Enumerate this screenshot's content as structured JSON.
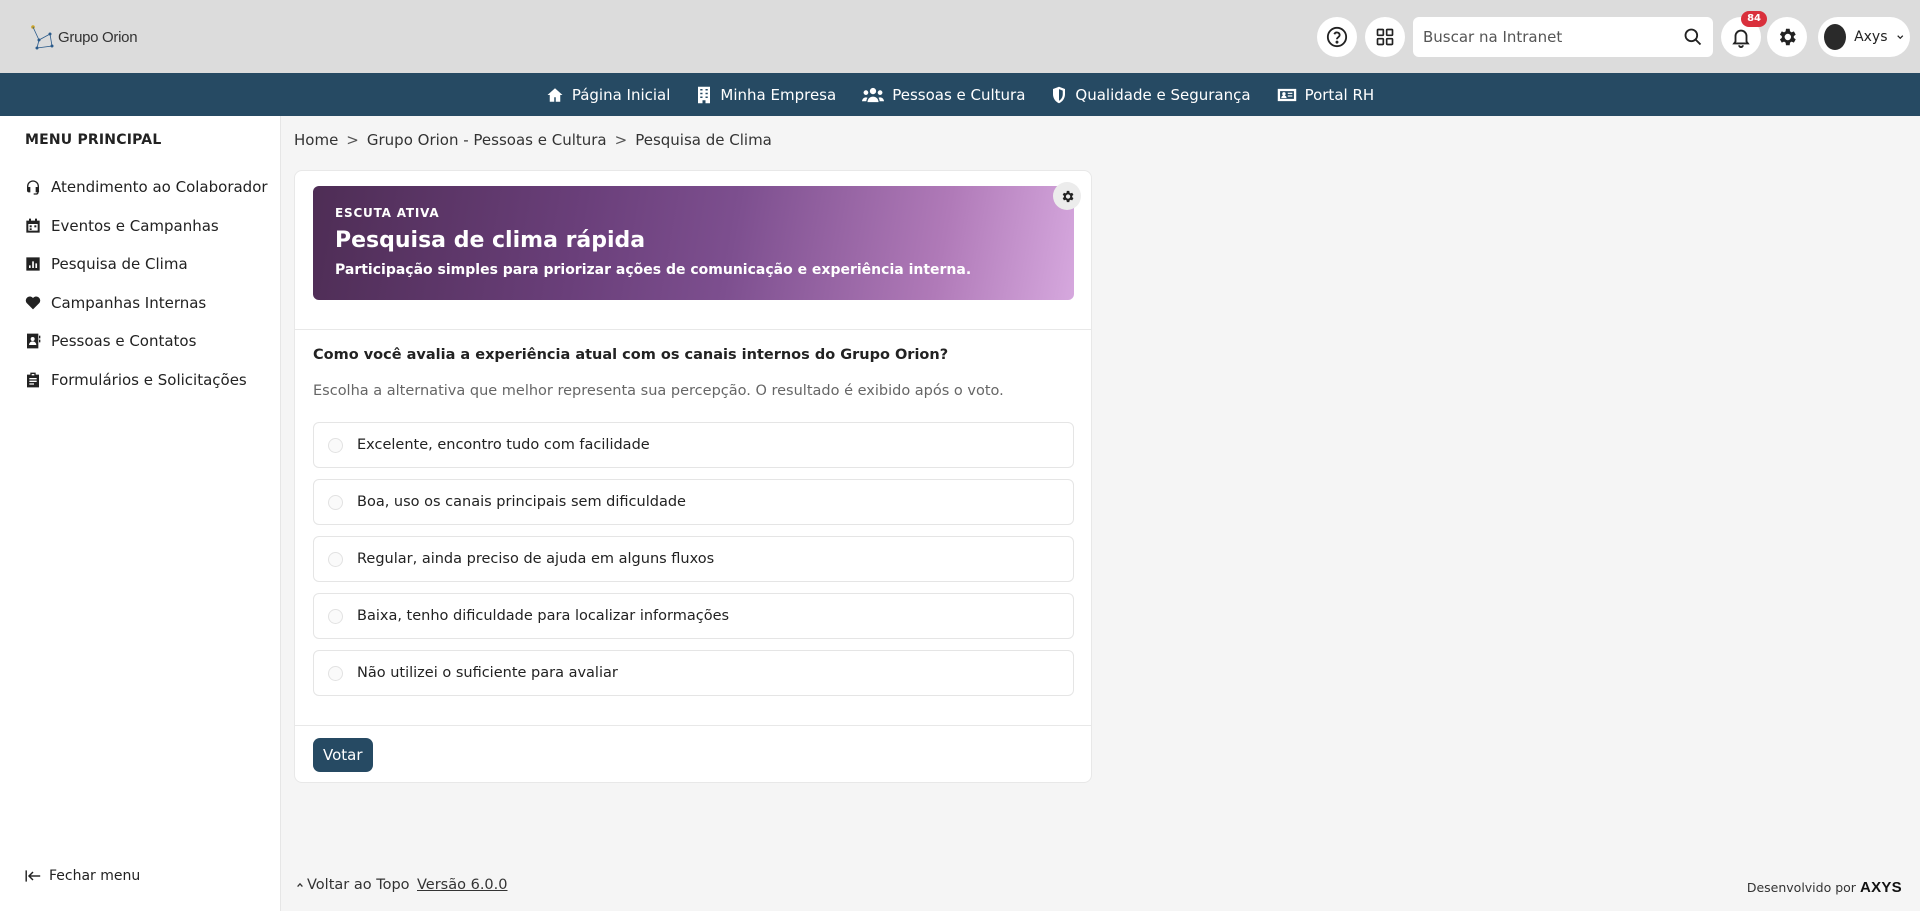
{
  "brand": {
    "name": "Grupo Orion"
  },
  "header": {
    "search_placeholder": "Buscar na Intranet",
    "notification_count": "84",
    "user_name": "Axys"
  },
  "nav": {
    "items": [
      {
        "label": "Página Inicial",
        "icon": "home-icon"
      },
      {
        "label": "Minha Empresa",
        "icon": "building-icon"
      },
      {
        "label": "Pessoas e Cultura",
        "icon": "people-icon"
      },
      {
        "label": "Qualidade e Segurança",
        "icon": "shield-icon"
      },
      {
        "label": "Portal RH",
        "icon": "id-card-icon"
      }
    ]
  },
  "sidebar": {
    "title": "MENU PRINCIPAL",
    "items": [
      {
        "label": "Atendimento ao Colaborador",
        "icon": "headset-icon"
      },
      {
        "label": "Eventos e Campanhas",
        "icon": "calendar-icon"
      },
      {
        "label": "Pesquisa de Clima",
        "icon": "chart-icon"
      },
      {
        "label": "Campanhas Internas",
        "icon": "heart-icon"
      },
      {
        "label": "Pessoas e Contatos",
        "icon": "contact-book-icon"
      },
      {
        "label": "Formulários e Solicitações",
        "icon": "clipboard-icon"
      }
    ],
    "close_label": "Fechar menu"
  },
  "breadcrumb": {
    "items": [
      "Home",
      "Grupo Orion - Pessoas e Cultura",
      "Pesquisa de Clima"
    ],
    "separator": ">"
  },
  "poll": {
    "eyebrow": "ESCUTA ATIVA",
    "title": "Pesquisa de clima rápida",
    "subtitle": "Participação simples para priorizar ações de comunicação e experiência interna.",
    "question": "Como você avalia a experiência atual com os canais internos do Grupo Orion?",
    "hint": "Escolha a alternativa que melhor representa sua percepção. O resultado é exibido após o voto.",
    "options": [
      "Excelente, encontro tudo com facilidade",
      "Boa, uso os canais principais sem dificuldade",
      "Regular, ainda preciso de ajuda em alguns fluxos",
      "Baixa, tenho dificuldade para localizar informações",
      "Não utilizei o suficiente para avaliar"
    ],
    "vote_label": "Votar"
  },
  "footer": {
    "back_to_top": "Voltar ao Topo",
    "version": "Versão 6.0.0",
    "developed_by": "Desenvolvido por",
    "developer_logo": "AXYS"
  },
  "colors": {
    "header_bg": "#dcdcdc",
    "nav_bg": "#264a63",
    "primary": "#264a63",
    "badge": "#d9303c",
    "banner_start": "#4e2d55",
    "banner_end": "#d6a8de"
  }
}
